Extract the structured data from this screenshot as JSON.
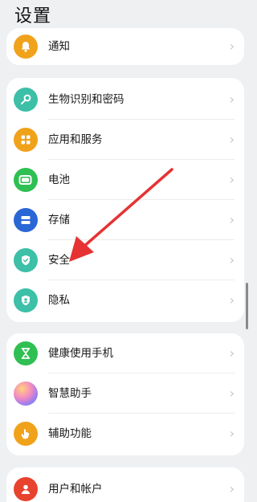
{
  "header": {
    "title": "设置"
  },
  "groups": [
    {
      "items": [
        {
          "label": "通知",
          "icon": "bell-icon",
          "color": "#f0a21b"
        }
      ]
    },
    {
      "items": [
        {
          "label": "生物识别和密码",
          "icon": "key-icon",
          "color": "#3dbfa8"
        },
        {
          "label": "应用和服务",
          "icon": "apps-icon",
          "color": "#f0a21b"
        },
        {
          "label": "电池",
          "icon": "battery-icon",
          "color": "#2fbf52"
        },
        {
          "label": "存储",
          "icon": "storage-icon",
          "color": "#2a67d6"
        },
        {
          "label": "安全",
          "icon": "shield-icon",
          "color": "#3dbfa8"
        },
        {
          "label": "隐私",
          "icon": "privacy-shield-icon",
          "color": "#3dbfa8"
        }
      ]
    },
    {
      "items": [
        {
          "label": "健康使用手机",
          "icon": "hourglass-icon",
          "color": "#2fbf52"
        },
        {
          "label": "智慧助手",
          "icon": "assistant-orb-icon",
          "color": "#b57be0"
        },
        {
          "label": "辅助功能",
          "icon": "hand-icon",
          "color": "#f0a21b"
        }
      ]
    },
    {
      "items": [
        {
          "label": "用户和帐户",
          "icon": "user-icon",
          "color": "#e8432f"
        }
      ]
    }
  ],
  "chevron": "›",
  "annotation": {
    "color": "#e63232"
  }
}
